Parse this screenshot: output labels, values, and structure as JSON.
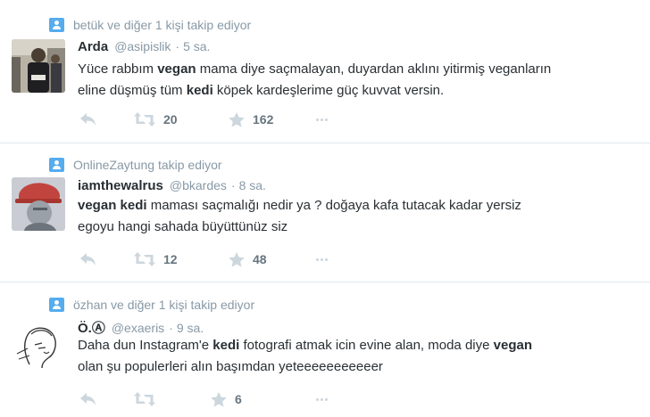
{
  "tweets": [
    {
      "context": "betük ve diğer 1 kişi takip ediyor",
      "fullname": "Arda",
      "username": "@asipislik",
      "separator": "·",
      "time": "5 sa.",
      "lines": [
        [
          {
            "t": "Yüce rabbım ",
            "b": false
          },
          {
            "t": "vegan",
            "b": true
          },
          {
            "t": " mama diye saçmalayan, duyardan aklını yitirmiş veganların",
            "b": false
          }
        ],
        [
          {
            "t": "eline düşmüş tüm ",
            "b": false
          },
          {
            "t": "kedi",
            "b": true
          },
          {
            "t": " köpek kardeşlerime güç kuvvat versin.",
            "b": false
          }
        ]
      ],
      "retweets": "20",
      "favorites": "162"
    },
    {
      "context": "OnlineZaytung takip ediyor",
      "fullname": "iamthewalrus",
      "username": "@bkardes",
      "separator": "·",
      "time": "8 sa.",
      "lines": [
        [
          {
            "t": "vegan",
            "b": true
          },
          {
            "t": " ",
            "b": false
          },
          {
            "t": "kedi",
            "b": true
          },
          {
            "t": " maması saçmalığı nedir ya ? doğaya kafa tutacak kadar yersiz",
            "b": false
          }
        ],
        [
          {
            "t": "egoyu hangi sahada büyüttünüz siz",
            "b": false
          }
        ]
      ],
      "retweets": "12",
      "favorites": "48"
    },
    {
      "context": "özhan ve diğer 1 kişi takip ediyor",
      "fullname": "Ö.Ⓐ",
      "username": "@exaeris",
      "separator": "·",
      "time": "9 sa.",
      "lines": [
        [
          {
            "t": "Daha dun Instagram'e ",
            "b": false
          },
          {
            "t": "kedi",
            "b": true
          },
          {
            "t": " fotografi atmak icin evine alan, moda diye ",
            "b": false
          },
          {
            "t": "vegan",
            "b": true
          }
        ],
        [
          {
            "t": "olan şu populerleri alın başımdan yeteeeeeeeeeeer",
            "b": false
          }
        ]
      ],
      "retweets": "",
      "favorites": "6"
    }
  ],
  "icons": {
    "context": "person-icon",
    "reply": "reply-icon",
    "retweet": "retweet-icon",
    "favorite": "star-icon",
    "more": "more-dots-icon"
  },
  "colors": {
    "accent": "#55acee",
    "muted": "#8899a6",
    "action": "#66757f",
    "text": "#292f33",
    "divider": "#e1e8ed"
  }
}
